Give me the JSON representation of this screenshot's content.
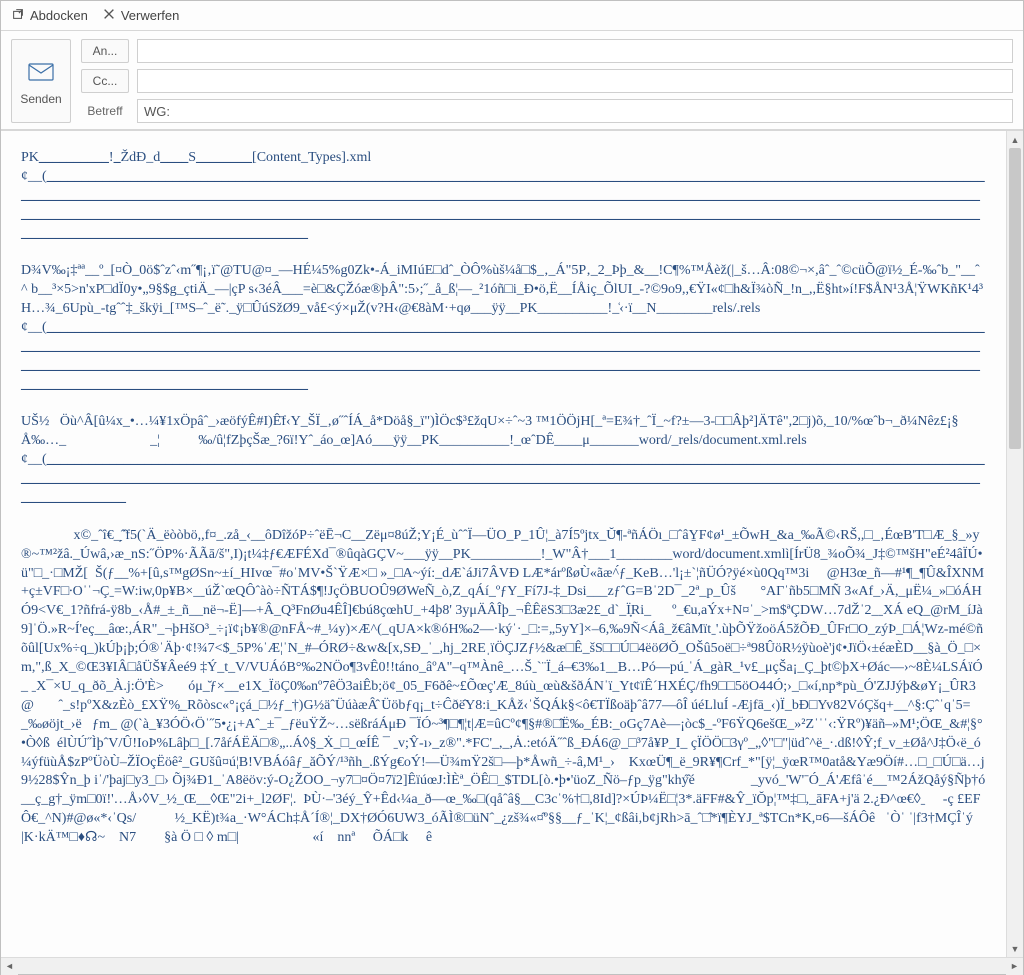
{
  "titlebar": {
    "undock": "Abdocken",
    "discard": "Verwerfen"
  },
  "compose": {
    "send_label": "Senden",
    "to_label": "An...",
    "cc_label": "Cc...",
    "subject_label": "Betreff",
    "to_value": "",
    "cc_value": "",
    "subject_value": "WG:"
  },
  "body": {
    "line1_a": "PK",
    "line1_b": "!",
    "line1_c": "ŽdĐ_d",
    "line1_d": "S",
    "line1_e": "[Content_Types].xml",
    "line2": "¢__(",
    "para1": "D¾V‰¡‡ªª__º_[¤Ò_0ö$ˆzˆ‹m˝¶¡‚ï˜@TU@¤_—HÉ¼5%g0Zk•-Á_iMIúE□dˆ_ÒÔ%ùš¼å□$_‚_Á\"5P‚_2_Þþ_&__!C¶%™Åèž(|_š…Â:08©¬×,âˆ_ˆ©cüÕ@ï½_É-‰ˆb_\"__ˆ^ b__³×5>n'xP□dÏ0y•„9§$g_çtiÄ_—|çP s‹3éÂ___=è□&ÇŽóæ®þÂ\":5›;˝_å_ß¦—_²1óñ□i_Ð•ö,Ë__ÍÅiç_ÕlUI_-?©9o9,,€ŸI«¢□h&Ï¾òÑ_!n_,,Ë§ht»í!F$ÅN¹3Å¦ŸWKñK¹4³H…¾_6Upù_-tgˆˆ‡_škÿi_[™S–ˆ_ë˜._ÿ□ÛúSžØ9_vå£<ý×μŽ(v?H‹@€8àM·+qø___ÿÿ__PK__________!_͑‹·ï__N________rels/.rels",
    "line3": "¢__(",
    "para2": "UŠ½   Öù^Â[û¼x_•…¼¥1xÖpâˆ_›æöfýÊ#I)Ê̄f‹Y_ŠÏ_‚ø˝ˆÍÁ_å*Döå§_ï\")ÌÖc$³£žqU×÷ˆ~3 ™1ÖÖjH[_ª=E¾†_ˆÏ_~f?±—3-□□Âþ²]ÄTê\",2□j)õ,_10/%œˆb¬_ð¼Nêz£¡§Å‰…_                        _¦           ‰/û¦fZþçŠæ_?6ï!Yˆ_áo_œ]Aó___ÿÿ__PK__________!_œˆDÊ____μ_______word/_rels/document.xml.rels",
    "line4": "¢__(",
    "para3": "               x©_ˆî€_̗ˆ̂f5(ˋÄ_ëòòbö,,f¤_.zå_‹__ôDîžóP÷ˆëĒ¬C__Zëμ¤8úŽ;Y¡É_ùˆˆÏ—ÜO_P_1Û¦_à7Í5ºjtx_Ŭ¶-ªñÁÖı_□ˆâY̱F¢ø¹_±ÕwH_&a_‰Ã©‹RŠ,,□_‚ÉœB'T□Æ_§_»y®~™²žâ._Úwâ,›æ_nS:˝ÖP%·ÃÃā/š\",I)¡t¼‡ƒ€ÆFÉXd¯®ûqàGÇV~___ÿÿ__PK__________!_W\"Â†___1________word/document.xmlì[ÍrÜ8_¾oÕ¾_J‡©™šH\"eÉ²4âÏÚ•ü\"□_·□MŽ[  Š(ƒ__%+[û,s™gØSn~±í_HIvœ¯#oˈMV•ŠˋŸÆ×□ »_□A~ýí:_dÆˋáJi7ÂVÐ LÆ*árºßøÙ«ãæ^́ƒ_KeB…'l¡±ˋ¦ñÜÓ?ÿé×ù0Qq™3i     @H3œ_ñ—#¹¶_¶Û&ÎXNM+ç±VF□∙Oˈˈ¬Çˍ=W:iw,0p¥B×_ˍúŽˋœQÔˆàò÷ÑTÁ$¶!JçÖBUOÛ9ØWeÑ_ò,Z_qÁí_ºƒY_Fí7J-‡_Dsi___zƒˆG=Bˈ2D¯_2ª_p_Ûš       °AΓˈñb5□MÑ 3«Af_›Ä,_μË¼_»□óÁHÓ9<V€_1?ñfrá-ÿ8b_‹Å#_±_ñ__në¬-Ë]—+Â_Q³FnØu4ÊÎ]€bú8çœhU_+4þ8' 3yμÄÂÎþ_¬ÊÊëS3□3æ2£_d`_Ï̟Ri_      º_€u,aÝx+N¤ˈ_>m$ªÇDW…7dŽˈ2_ˍXÁ eQ_@rM_íJà9]ˈÖ.»R~Í'eç__âœ:,ÁR\"_¬þHšO³_÷¡ï¢¡b¥®@nFÅ~#_¼y)×Æ^(_qUA×k®óH‰2—·kýˈ·_□:=„5yY]×–6,‰9Ñ<Áâ_ž€âMïtˍ'.ùþÕŸžoöÁ5žÕÐ_ÛFr□O_zýÞ_□Á¦Wz-mé©ñõûl[Ux%÷q_)kÚþ¡þ;Ó®ˈÄþ·¢!¾7<$_5P%ˈÆ¦ˈN_#–ÓRØ÷&w&[x,SÐ_ˈ_,hj_2REˌïÖÇJZƒ½&æ□Ê_šS□□Ú□4ëöØŎ_OŠû5oë□÷ª98ÛöR½ÿùoè'j¢•JïÖ‹±éæÈD__§à_Ö_□×m,\",ß_X_©Œ3¥IÂ□åÜŠ¥Âeé9 ‡Ý_t_V/VUÁóB°‰2NÖo¶3vÊ0!!táno_âºA\"–q™Ànê_…Šˍˋ¨Ï_á–€3‰1_ˍB…Pó—púˍˈÁ_gàR_¹v£_μçŠa¡_Ç_þt©þX+Øác—›~8È¼LSÁïÓ_ ˍX¯×U_q_ðõ_À.j:Ö'È>       óμ_̆ƒ×__e1X_ÏöÇ0‰nº7êÖ3aiÊb;ö¢_05_F6ðê~£Õœç'Æ_8úù_œù&šðÁNˈï_Yt¢ïÊˊHXÉÇ/fh9□□5öO44Ó;›_□«í,np*pù_Ó'ZJJýþ&øY¡_ÛR3@       ˆ_s!pºX&zÈò_£XŸ%̱_Rõòsc«°¡çá_□½ƒ_†)G½äˆÜúàæÂ̂ Üöbƒq¡_t÷Ĉðë̂Y8:i_KÅž‹ˈŠQÁk§<ô€TÏßoäþˆâ77—ôÎ úéLluÍ -Æjfā_‹)Ï_bÐ□Yv82VóÇšq+__^§:Çˆˈqˈ5=        _‰øöjt_›ë   ƒm_ @(ˋà_¥3ÓÖ‹Öˈ˝5•¿¡+Aˆ_±¯_ƒëuŸŽ~…sëßráÁμÐ ¯ÏÓ~³¶□¶¦t|Æ=ûCº¢¶§#®□̂Ë‰_ÉB:_oGç7Aè—¡òc$_-ºF6ŸQ6ešŒ_»²Zˈˈˈ‹:ŸRº)¥äñ–»M¹;ÖŒ_&#¦§°•Ò◊ß  élÙÚ˝ÌþˆV/Û!IoÞ%Lâþ□_[.7åŕÁËÄ□®„..Á◊§_Ẋ_□_œÍÊ ¯ ˍv;Ŷ-ı›_z®\".*FC'_,_,Ȧ.:etóÄ˝ˆß_ÐÁ6@_□³7å¥P_I_ çÏÖÖ□3γº_„◊\"□\"|üdˆ^ë_·.dß!◊Ŷ;f_v_±Øå^J‡Ö‹ë_ó¼ýfüùÅ$zPºÜòÙ–ŽÏOçËöê²_GUšû¤ú¦B!VBÁóâƒ_ăÕÝ/¹³ñh_.ßÝg€oÝ!—Ü¾mŸ2š□—þ*Åwñ_÷-â,M¹_›    KxœÜ¶_ë_9R¥¶Crf_*\"[ÿ¦_ÿœR™0atå&Yæ9Öí#…□_□Ú□ä…j             9½28$Ŷn_þ iˈ/'þaj□y3_□› Õj¾Ð1_ˈA8ëöv:ý-O¿ŽOO_¬y7□¤Ö¤7ï2]ÊïúœJ:ÌÈª_ÖÊ□_$TDL[ò.•þ•'üoZ_Ñö–ƒp_ÿg\"khý̂é                _yvó_'W'ˉÓ_Á'Æfâˈé__™2ÁžQåý§Ñþ†ó__ç_g†_ÿm□0ï!'…Å›◊V_½_Œ__◊Œ\"2i+_l2ØF¦.  ÞÙ·–'3éý_Ŷ+Êd‹¼a_ð—œ_‰□(qåˆâ§__C3cˈ%†□,8Id]?×ÚÞ¼Ë□¦3*.äFF#&Ŷ_ïŎp¦™‡□,_āFA+j'ä 2.¿Ð^œ€◊ˍ     -ç £EFÔ€_^N)#@ø«*‹ˈQs/           ½_KË)t¾a_·W°ÁCh‡Å´Í®¦_DX†ØÓ6UW3_óÃÌ®□üNˆ_¿zš¾«¤̂º§§__ƒ_ˈK¦_¢ßâi,b¢jRh>ā_ˆ□̂*ï¶ÈYJ_ª$TCn*K,¤6—šÁÔê   ˈÒˈ ˈ|f3†MÇÎˈý   |K·kÄ™□♦☊~    N7        §à Ö □ ◊ m□|                     «í    nnª     ÕÁ□k     ê"
  }
}
